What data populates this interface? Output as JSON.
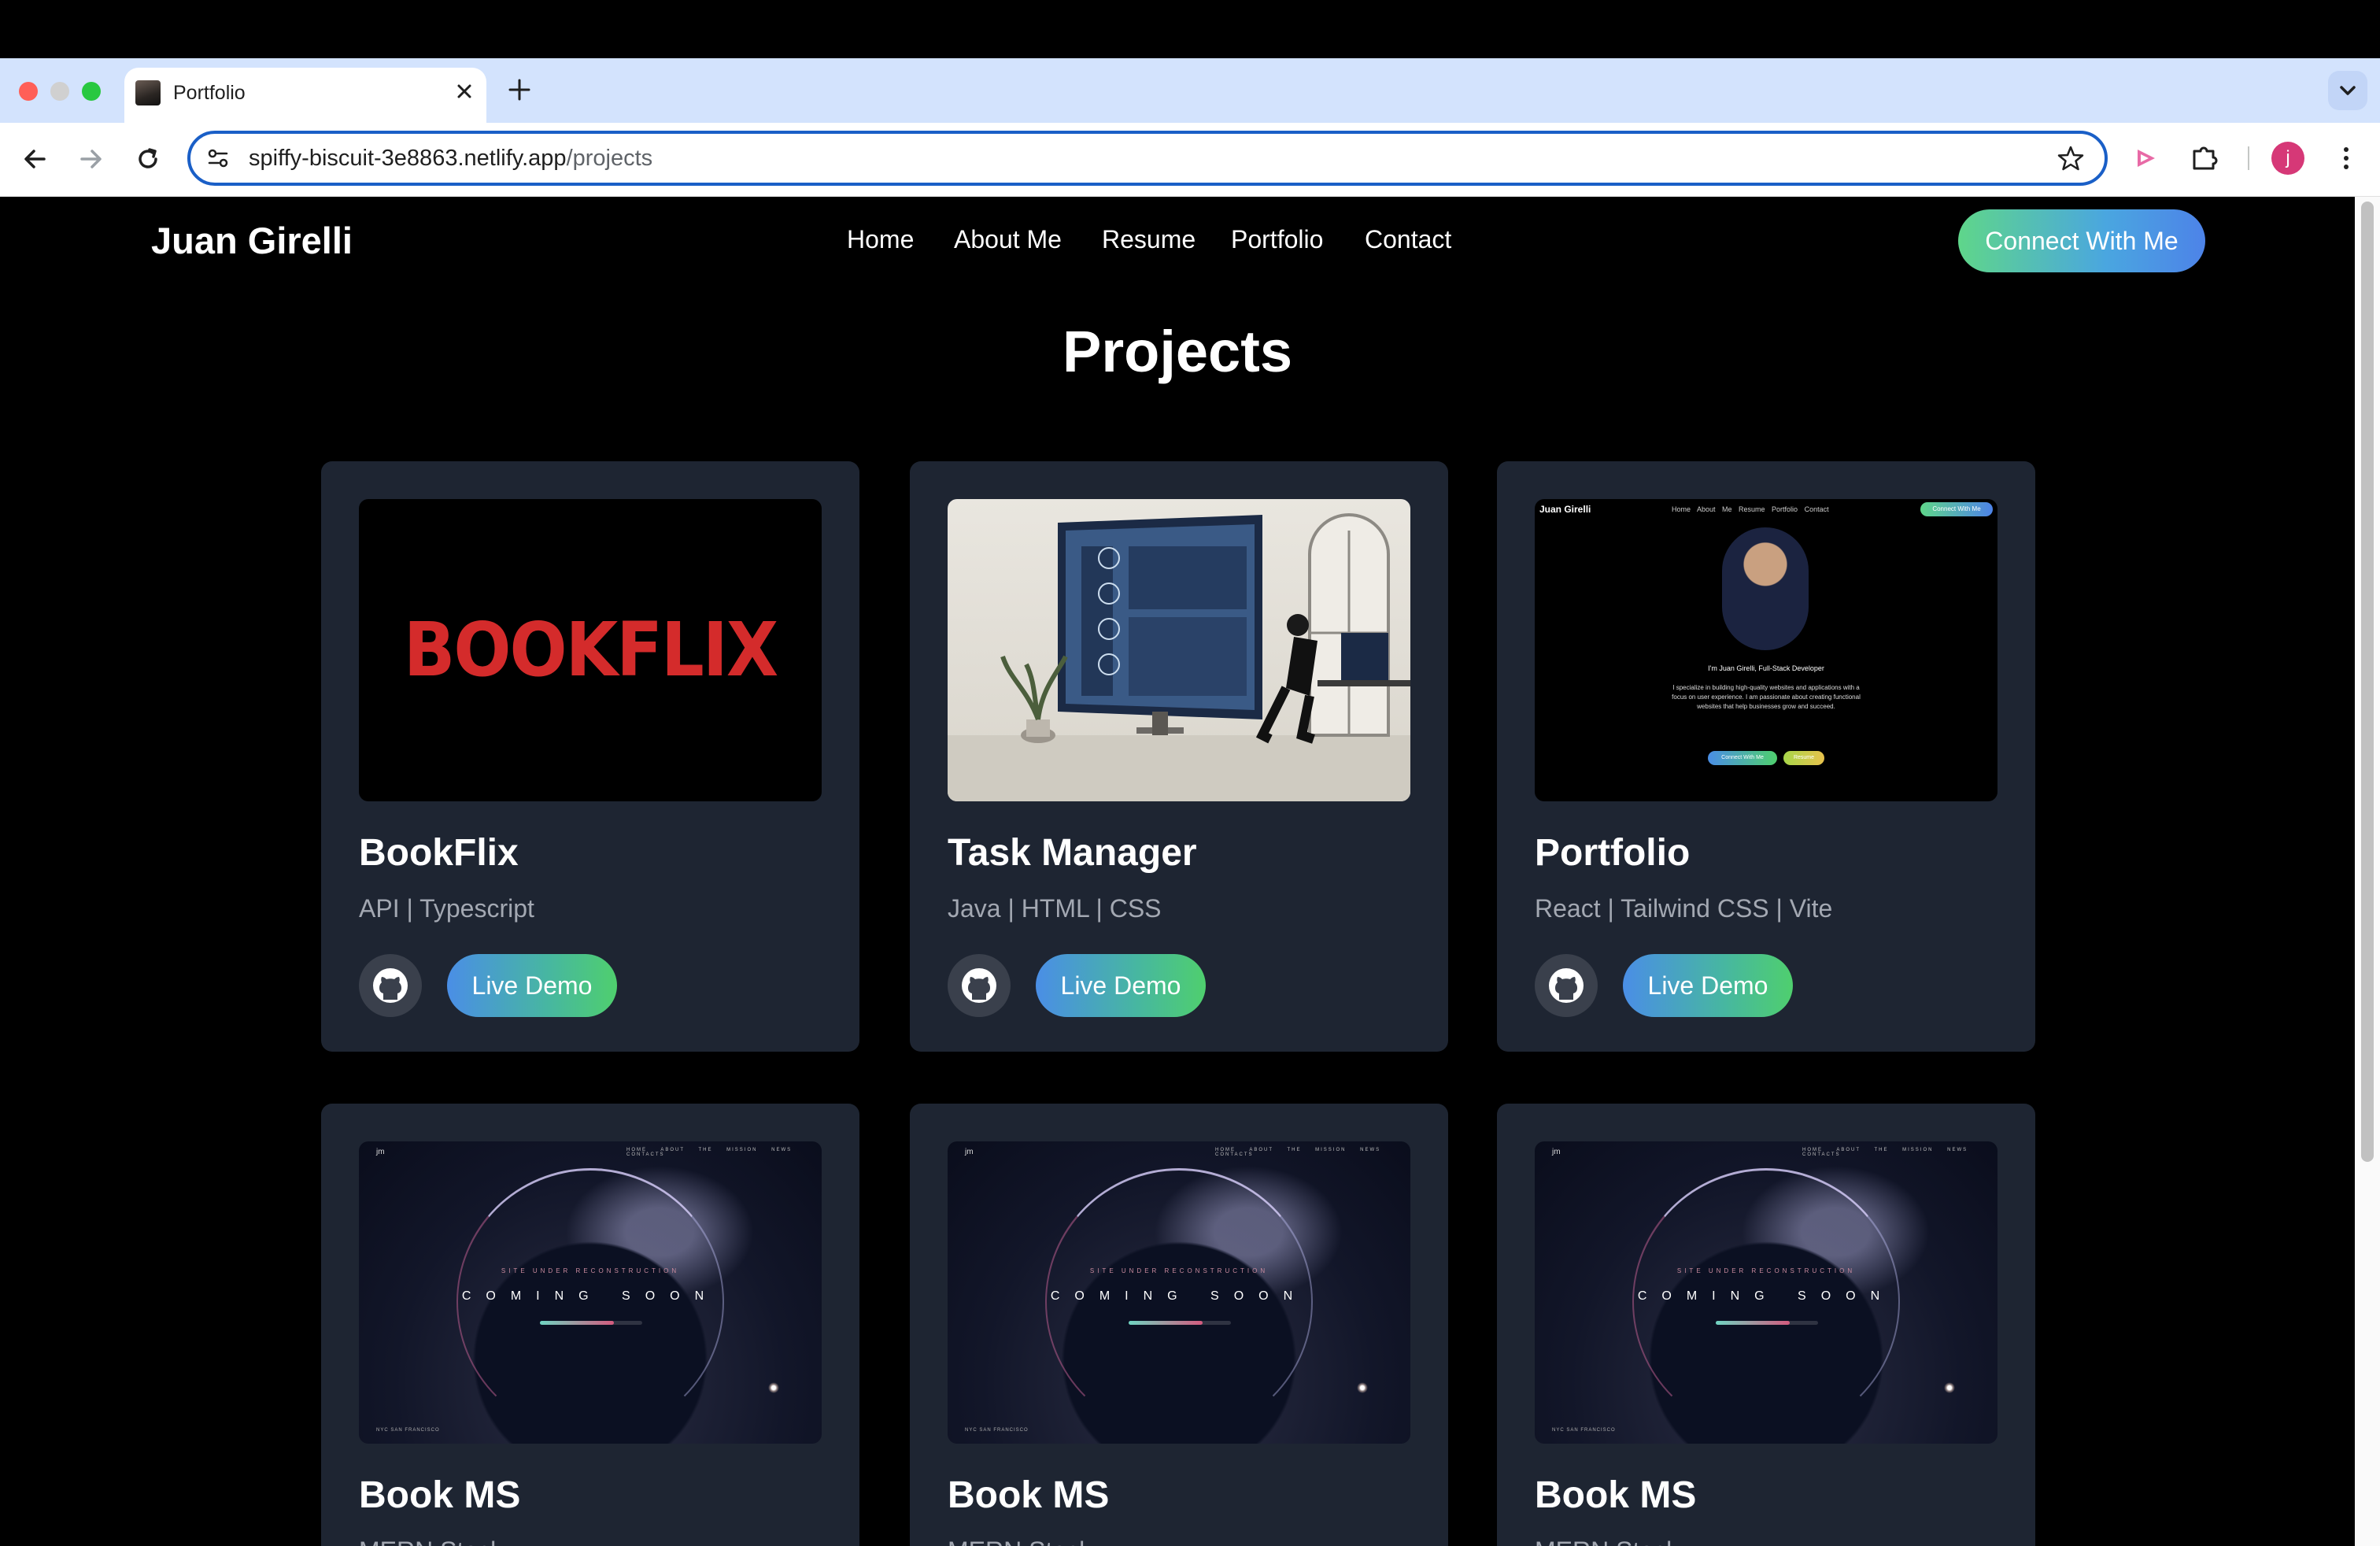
{
  "browser": {
    "tab_title": "Portfolio",
    "url_host": "spiffy-biscuit-3e8863.netlify.app",
    "url_path": "/projects",
    "profile_initial": "j"
  },
  "site": {
    "brand": "Juan Girelli",
    "nav": [
      "Home",
      "About Me",
      "Resume",
      "Portfolio",
      "Contact"
    ],
    "cta": "Connect With Me",
    "page_title": "Projects"
  },
  "projects": [
    {
      "title": "BookFlix",
      "tech": "API | Typescript",
      "demo": "Live Demo",
      "thumb_text": "BOOKFLIX"
    },
    {
      "title": "Task Manager",
      "tech": "Java | HTML | CSS",
      "demo": "Live Demo"
    },
    {
      "title": "Portfolio",
      "tech": "React | Tailwind CSS | Vite",
      "demo": "Live Demo",
      "thumb": {
        "brand": "Juan Girelli",
        "nav": "Home About Me Resume Portfolio Contact",
        "cta": "Connect With Me",
        "intro": "I'm Juan Girelli, Full-Stack Developer",
        "desc": "I specialize in building high-quality websites and applications with a focus on user experience. I am passionate about creating functional websites that help businesses grow and succeed.",
        "btn1": "Connect With Me",
        "btn2": "Resume"
      }
    },
    {
      "title": "Book MS",
      "tech": "MERN Stack"
    },
    {
      "title": "Book MS",
      "tech": "MERN Stack"
    },
    {
      "title": "Book MS",
      "tech": "MERN Stack"
    }
  ],
  "coming_soon": {
    "logo": "jm",
    "nav": "HOME ABOUT THE MISSION NEWS CONTACTS",
    "subtitle": "SITE UNDER RECONSTRUCTION",
    "text": "COMING SOON",
    "location": "NYC SAN FRANCISCO"
  },
  "colors": {
    "card_bg": "#1e2532",
    "cta_gradient": [
      "#5fd68a",
      "#4d83e8"
    ],
    "demo_gradient": [
      "#4a8ee6",
      "#4fcf6e"
    ],
    "bookflix_red": "#d42b2b",
    "omnibox_focus": "#1a5fc7"
  }
}
